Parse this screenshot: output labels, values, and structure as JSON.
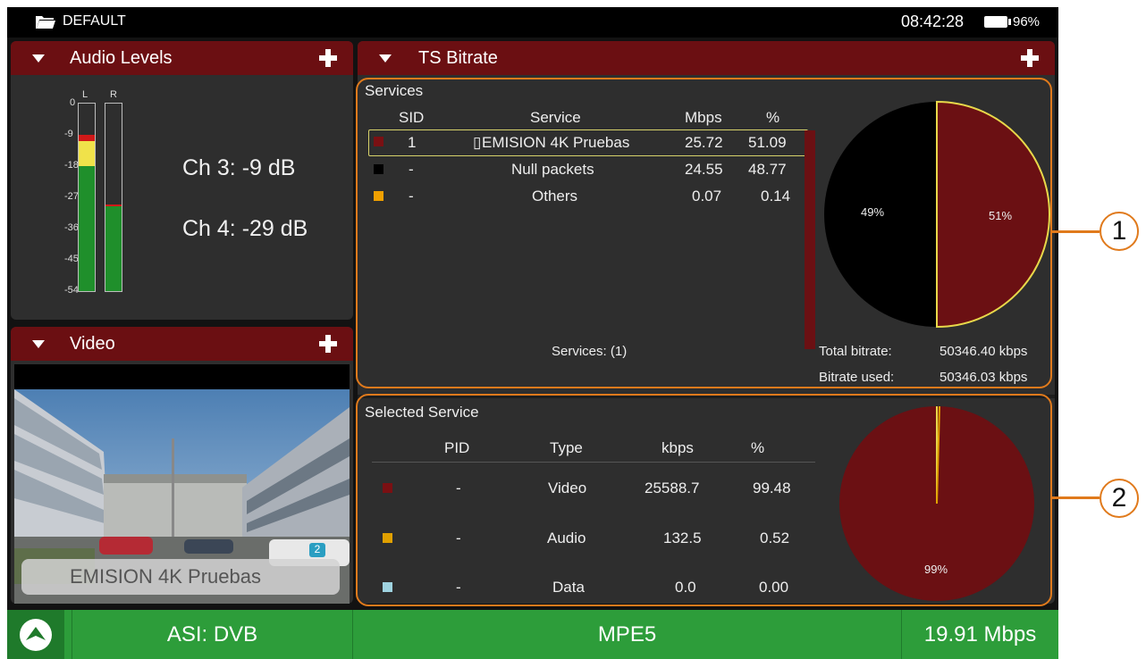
{
  "statusbar": {
    "profile": "DEFAULT",
    "time": "08:42:28",
    "battery": "96%"
  },
  "audio": {
    "title": "Audio Levels",
    "channel_labels": [
      "L",
      "R"
    ],
    "scale": [
      "0",
      "-9",
      "-18",
      "-27",
      "-36",
      "-45",
      "-54"
    ],
    "ch3": "Ch 3:  -9 dB",
    "ch4": "Ch 4:  -29 dB",
    "level_left_db": -9,
    "level_right_db": -29
  },
  "video": {
    "title": "Video",
    "overlay": "EMISION 4K Pruebas",
    "badge": "2"
  },
  "ts_bitrate": {
    "title": "TS Bitrate",
    "section": "Services",
    "headers": [
      "SID",
      "Service",
      "Mbps",
      "%"
    ],
    "rows": [
      {
        "color": "#7a1013",
        "sid": "1",
        "service": "▯",
        "service_name": "EMISION 4K Pruebas",
        "mbps": "25.72",
        "pct": "51.09"
      },
      {
        "color": "#000000",
        "sid": "-",
        "service": "",
        "service_name": "Null packets",
        "mbps": "24.55",
        "pct": "48.77"
      },
      {
        "color": "#f0a000",
        "sid": "-",
        "service": "",
        "service_name": "Others",
        "mbps": "0.07",
        "pct": "0.14"
      }
    ],
    "count": "Services: (1)",
    "total_label": "Total bitrate:",
    "total_value": "50346.40 kbps",
    "used_label": "Bitrate used:",
    "used_value": "50346.03 kbps",
    "pie_labels": [
      "49%",
      "51%"
    ]
  },
  "selected_service": {
    "title": "Selected Service",
    "headers": [
      "PID",
      "Type",
      "kbps",
      "%"
    ],
    "rows": [
      {
        "color": "#7a1013",
        "pid": "-",
        "type": "Video",
        "kbps": "25588.7",
        "pct": "99.48"
      },
      {
        "color": "#e0a000",
        "pid": "-",
        "type": "Audio",
        "kbps": "132.5",
        "pct": "0.52"
      },
      {
        "color": "#9fd3e0",
        "pid": "-",
        "type": "Data",
        "kbps": "0.0",
        "pct": "0.00"
      }
    ],
    "pie_label": "99%"
  },
  "callouts": [
    "1",
    "2"
  ],
  "bottombar": {
    "input": "ASI: DVB",
    "mode": "MPE5",
    "rate": "19.91 Mbps"
  },
  "colors": {
    "header": "#6b0f12",
    "accent": "#e07a1c",
    "bottombar": "#2d9d3a"
  }
}
